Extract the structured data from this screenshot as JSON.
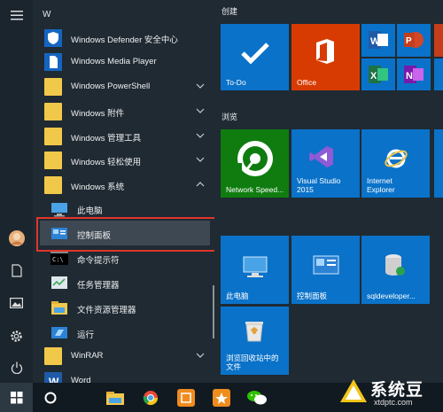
{
  "applist": {
    "section_letter": "W",
    "items": [
      {
        "label": "Windows Defender 安全中心"
      },
      {
        "label": "Windows Media Player"
      },
      {
        "label": "Windows PowerShell"
      },
      {
        "label": "Windows 附件"
      },
      {
        "label": "Windows 管理工具"
      },
      {
        "label": "Windows 轻松使用"
      },
      {
        "label": "Windows 系统"
      },
      {
        "label": "此电脑"
      },
      {
        "label": "控制面板"
      },
      {
        "label": "命令提示符"
      },
      {
        "label": "任务管理器"
      },
      {
        "label": "文件资源管理器"
      },
      {
        "label": "运行"
      },
      {
        "label": "WinRAR"
      },
      {
        "label": "Word"
      }
    ]
  },
  "tiles": {
    "group1": "创建",
    "group2": "浏览",
    "todo": "To-Do",
    "office": "Office",
    "network": "Network Speed...",
    "vs": "Visual Studio\n2015",
    "ie": "Internet\nExplorer",
    "pc": "此电脑",
    "cp": "控制面板",
    "sql": "sqldeveloper...",
    "recycle": "浏览回收站中的\n文件"
  },
  "watermark": {
    "title": "系统豆",
    "url": "xtdptc.com"
  },
  "colors": {
    "tile_blue": "#0a72c9",
    "office_red": "#d83b01",
    "network_green": "#107c10",
    "highlight_border": "#e0352b"
  }
}
